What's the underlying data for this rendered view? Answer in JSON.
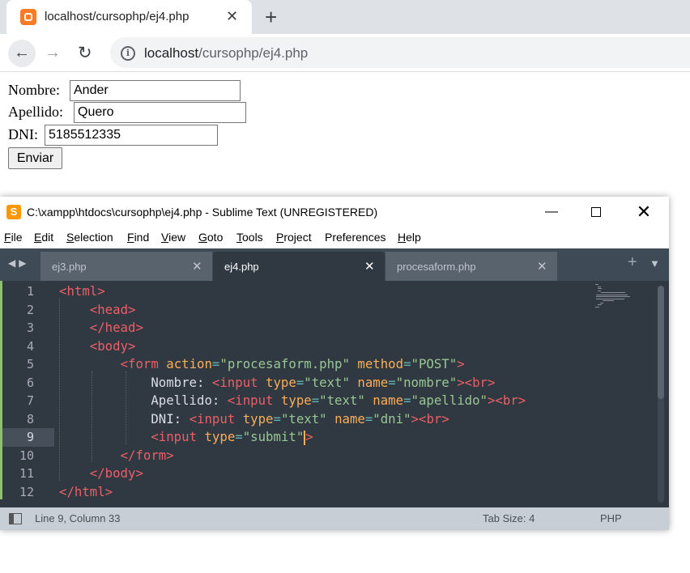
{
  "browser": {
    "tab_title": "localhost/cursophp/ej4.php",
    "close_glyph": "✕",
    "newtab_glyph": "+",
    "url_host": "localhost",
    "url_path": "/cursophp/ej4.php",
    "back_glyph": "←",
    "forward_glyph": "→",
    "reload_glyph": "↻",
    "info_glyph": "i"
  },
  "form": {
    "nombre_label": "Nombre:",
    "nombre_value": "Ander",
    "apellido_label": "Apellido:",
    "apellido_value": "Quero",
    "dni_label": "DNI:",
    "dni_value": "5185512335",
    "submit_label": "Enviar"
  },
  "sublime": {
    "title": "C:\\xampp\\htdocs\\cursophp\\ej4.php - Sublime Text (UNREGISTERED)",
    "logo_glyph": "S",
    "min_glyph": "—",
    "close_glyph": "✕",
    "menu": [
      {
        "u": "F",
        "rest": "ile"
      },
      {
        "u": "E",
        "rest": "dit"
      },
      {
        "u": "S",
        "rest": "election"
      },
      {
        "u": "F",
        "rest": "ind"
      },
      {
        "u": "V",
        "rest": "iew"
      },
      {
        "u": "G",
        "rest": "oto"
      },
      {
        "u": "T",
        "rest": "ools"
      },
      {
        "u": "P",
        "rest": "roject"
      },
      {
        "u": "",
        "rest": "Preferences"
      },
      {
        "u": "H",
        "rest": "elp"
      }
    ],
    "tabs": [
      {
        "name": "ej3.php",
        "active": false
      },
      {
        "name": "ej4.php",
        "active": true
      },
      {
        "name": "procesaform.php",
        "active": false
      }
    ],
    "tab_close_glyph": "✕",
    "tab_arrows": "◀▶",
    "tab_plus": "+",
    "tab_down": "▼",
    "line_numbers": [
      "1",
      "2",
      "3",
      "4",
      "5",
      "6",
      "7",
      "8",
      "9",
      "10",
      "11",
      "12"
    ],
    "current_line": "9",
    "code_lines": [
      [
        [
          "tg",
          "<"
        ],
        [
          "tg",
          "html"
        ],
        [
          "tg",
          ">"
        ]
      ],
      [
        [
          "tx",
          "    "
        ],
        [
          "tg",
          "<"
        ],
        [
          "tg",
          "head"
        ],
        [
          "tg",
          ">"
        ]
      ],
      [
        [
          "tx",
          "    "
        ],
        [
          "tg",
          "</"
        ],
        [
          "tg",
          "head"
        ],
        [
          "tg",
          ">"
        ]
      ],
      [
        [
          "tx",
          "    "
        ],
        [
          "tg",
          "<"
        ],
        [
          "tg",
          "body"
        ],
        [
          "tg",
          ">"
        ]
      ],
      [
        [
          "tx",
          "        "
        ],
        [
          "tg",
          "<"
        ],
        [
          "tg",
          "form"
        ],
        [
          "tx",
          " "
        ],
        [
          "at",
          "action"
        ],
        [
          "pn",
          "="
        ],
        [
          "st",
          "\"procesaform.php\""
        ],
        [
          "tx",
          " "
        ],
        [
          "at",
          "method"
        ],
        [
          "pn",
          "="
        ],
        [
          "st",
          "\"POST\""
        ],
        [
          "tg",
          ">"
        ]
      ],
      [
        [
          "tx",
          "            Nombre: "
        ],
        [
          "tg",
          "<"
        ],
        [
          "tg",
          "input"
        ],
        [
          "tx",
          " "
        ],
        [
          "at",
          "type"
        ],
        [
          "pn",
          "="
        ],
        [
          "st",
          "\"text\""
        ],
        [
          "tx",
          " "
        ],
        [
          "at",
          "name"
        ],
        [
          "pn",
          "="
        ],
        [
          "st",
          "\"nombre\""
        ],
        [
          "tg",
          ">"
        ],
        [
          "tg",
          "<"
        ],
        [
          "tg",
          "br"
        ],
        [
          "tg",
          ">"
        ]
      ],
      [
        [
          "tx",
          "            Apellido: "
        ],
        [
          "tg",
          "<"
        ],
        [
          "tg",
          "input"
        ],
        [
          "tx",
          " "
        ],
        [
          "at",
          "type"
        ],
        [
          "pn",
          "="
        ],
        [
          "st",
          "\"text\""
        ],
        [
          "tx",
          " "
        ],
        [
          "at",
          "name"
        ],
        [
          "pn",
          "="
        ],
        [
          "st",
          "\"apellido\""
        ],
        [
          "tg",
          ">"
        ],
        [
          "tg",
          "<"
        ],
        [
          "tg",
          "br"
        ],
        [
          "tg",
          ">"
        ]
      ],
      [
        [
          "tx",
          "            DNI: "
        ],
        [
          "tg",
          "<"
        ],
        [
          "tg",
          "input"
        ],
        [
          "tx",
          " "
        ],
        [
          "at",
          "type"
        ],
        [
          "pn",
          "="
        ],
        [
          "st",
          "\"text\""
        ],
        [
          "tx",
          " "
        ],
        [
          "at",
          "name"
        ],
        [
          "pn",
          "="
        ],
        [
          "st",
          "\"dni\""
        ],
        [
          "tg",
          ">"
        ],
        [
          "tg",
          "<"
        ],
        [
          "tg",
          "br"
        ],
        [
          "tg",
          ">"
        ]
      ],
      [
        [
          "tx",
          "            "
        ],
        [
          "tg",
          "<"
        ],
        [
          "tg",
          "input"
        ],
        [
          "tx",
          " "
        ],
        [
          "at",
          "type"
        ],
        [
          "pn",
          "="
        ],
        [
          "st",
          "\"submit\""
        ],
        [
          "caret",
          ""
        ],
        [
          "tg",
          ">"
        ]
      ],
      [
        [
          "tx",
          "        "
        ],
        [
          "tg",
          "</"
        ],
        [
          "tg",
          "form"
        ],
        [
          "tg",
          ">"
        ]
      ],
      [
        [
          "tx",
          "    "
        ],
        [
          "tg",
          "</"
        ],
        [
          "tg",
          "body"
        ],
        [
          "tg",
          ">"
        ]
      ],
      [
        [
          "tg",
          "</"
        ],
        [
          "tg",
          "html"
        ],
        [
          "tg",
          ">"
        ]
      ]
    ],
    "status": {
      "position": "Line 9, Column 33",
      "tab_size": "Tab Size: 4",
      "syntax": "PHP"
    },
    "colors": {
      "editor_bg": "#303841",
      "tag": "#ec5f66",
      "attribute": "#f9ae58",
      "string": "#99c794",
      "punctuation": "#5fb4b4",
      "text": "#d8dee9"
    }
  }
}
